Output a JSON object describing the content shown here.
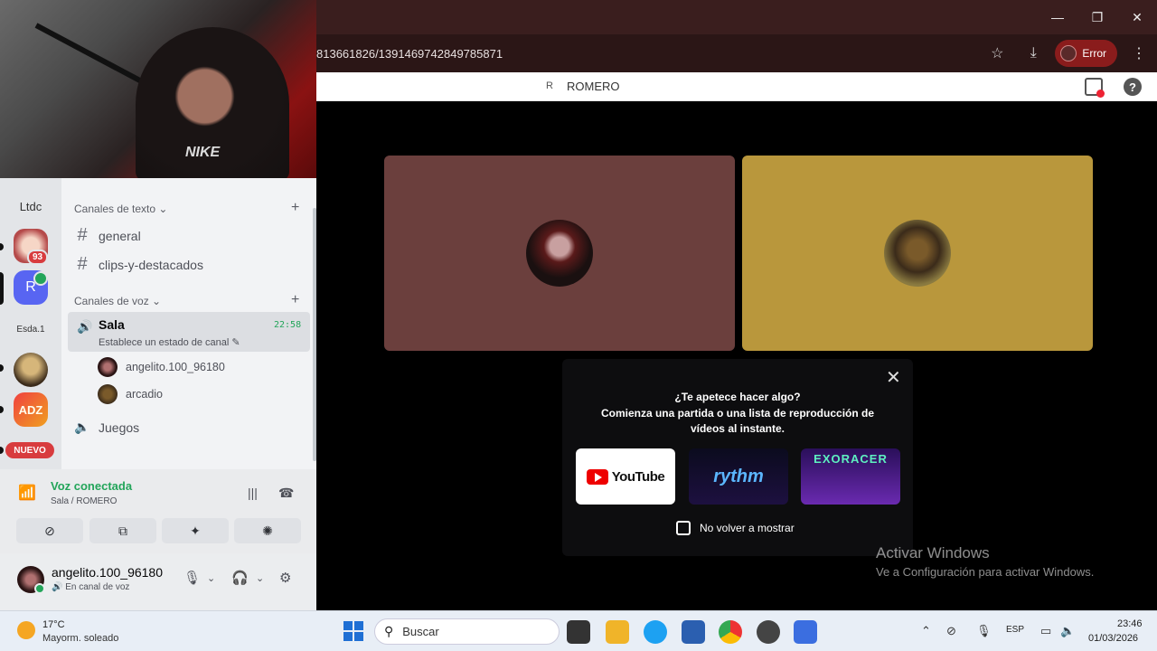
{
  "browser": {
    "url": "813661826/1391469742849785871",
    "profile_label": "Error",
    "window_controls": [
      "minimize-icon",
      "restore-icon",
      "close-icon"
    ]
  },
  "discord_header": {
    "server_initial": "R",
    "server_name": "ROMERO"
  },
  "servers": {
    "ltdc_label": "Ltdc",
    "eye_badge": "93",
    "r_label": "R",
    "esda_label": "Esda.1",
    "adz_label": "ADZ",
    "new_label": "NUEVO"
  },
  "channels": {
    "text_category": "Canales de texto",
    "text_channels": [
      "general",
      "clips-y-destacados"
    ],
    "voice_category": "Canales de voz",
    "sala": {
      "name": "Sala",
      "time": "22:58",
      "status_hint": "Establece un estado de canal"
    },
    "members": [
      "angelito.100_96180",
      "arcadio"
    ],
    "juegos": "Juegos"
  },
  "voice_panel": {
    "status": "Voz conectada",
    "location": "Sala / ROMERO"
  },
  "user_panel": {
    "username": "angelito.100_96180",
    "status": "En canal de voz"
  },
  "activity_prompt": {
    "question": "¿Te apetece hacer algo?",
    "description": "Comienza una partida o una lista de reproducción de vídeos al instante.",
    "activities": [
      "YouTube",
      "rythm",
      "EXORACER"
    ],
    "dont_show_label": "No volver a mostrar"
  },
  "watermark": {
    "title": "Activar Windows",
    "subtitle": "Ve a Configuración para activar Windows."
  },
  "taskbar": {
    "weather_temp": "17°C",
    "weather_desc": "Mayorm. soleado",
    "search_placeholder": "Buscar",
    "language": "ESP",
    "time": "23:46",
    "date": "01/03/2026"
  },
  "colors": {
    "tile_1": "#6b3f3d",
    "tile_2": "#b9973c",
    "voice_green": "#23a55a",
    "discord_blurple": "#5865f2",
    "chrome_profile": "#8a1c1c"
  }
}
